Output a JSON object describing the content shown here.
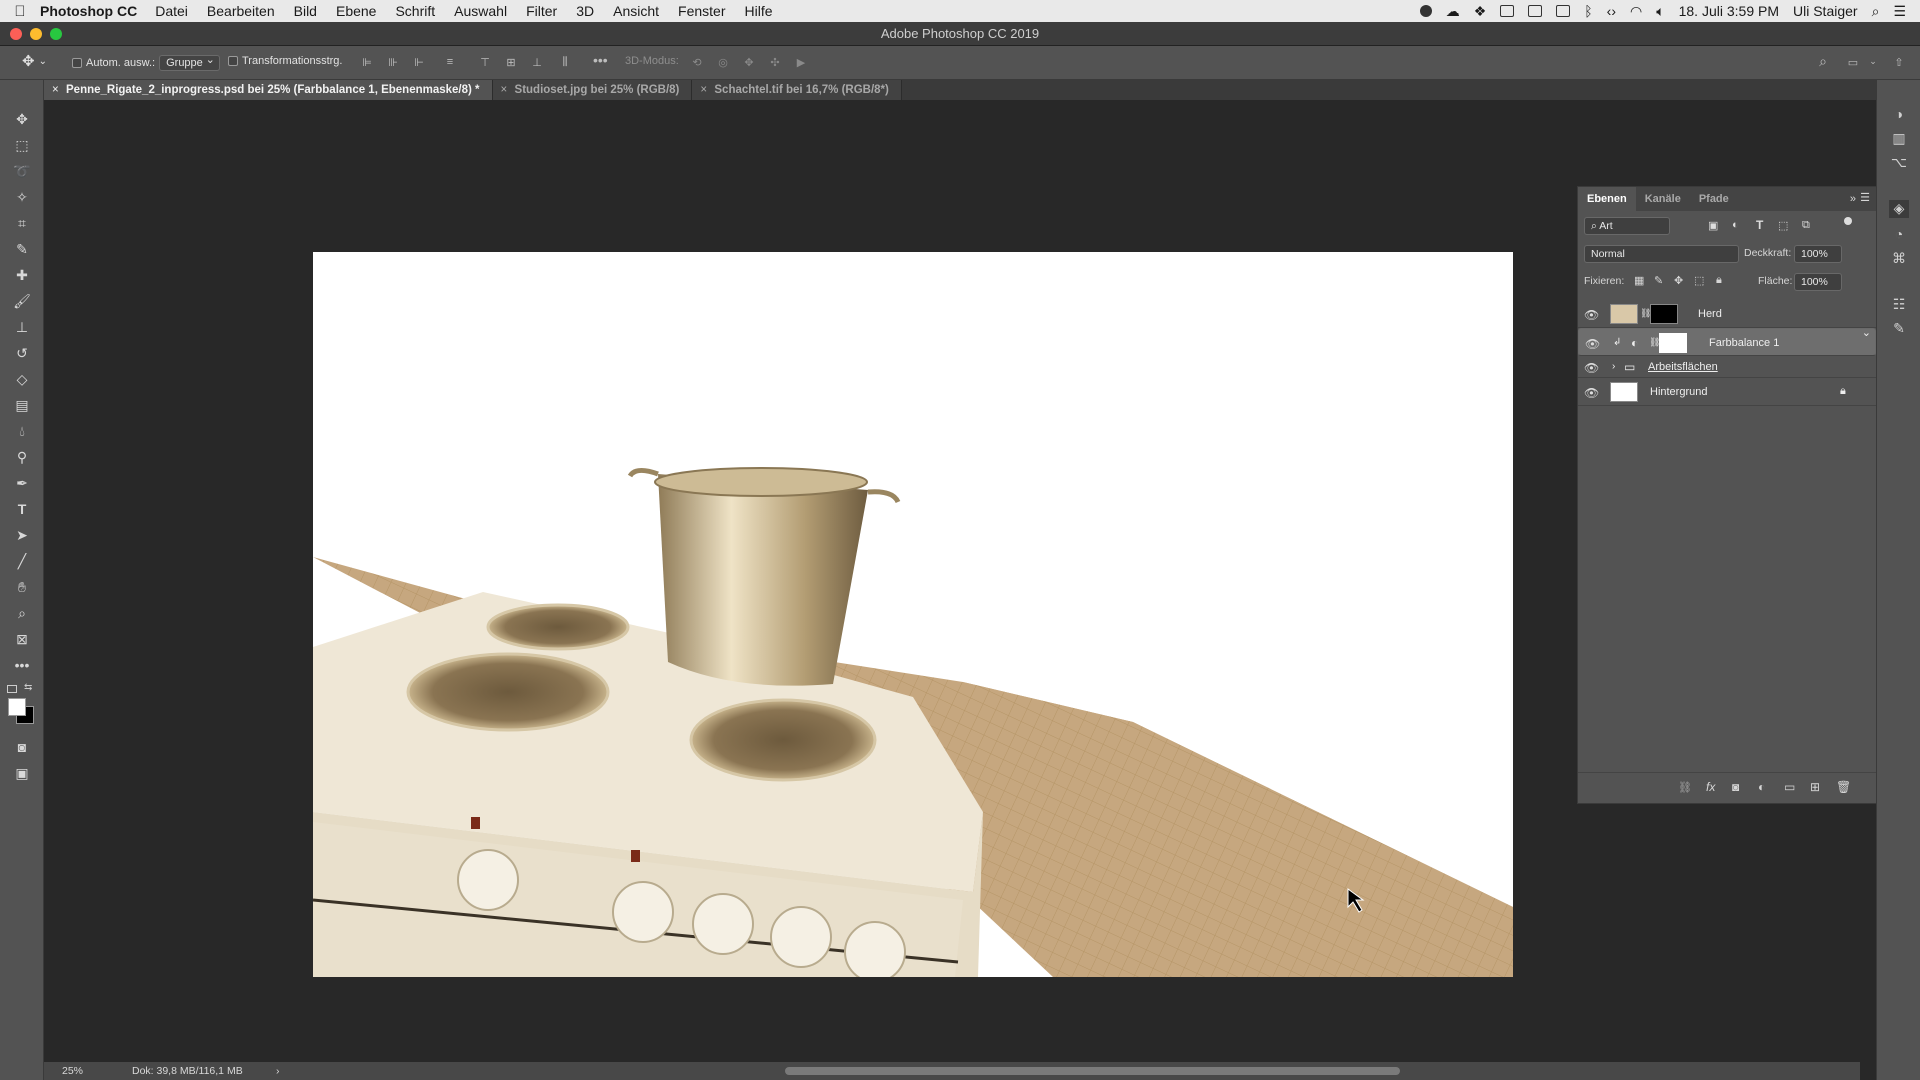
{
  "menubar": {
    "app_name": "Photoshop CC",
    "items": [
      "Datei",
      "Bearbeiten",
      "Bild",
      "Ebene",
      "Schrift",
      "Auswahl",
      "Filter",
      "3D",
      "Ansicht",
      "Fenster",
      "Hilfe"
    ],
    "date_time": "18. Juli  3:59 PM",
    "user": "Uli Staiger"
  },
  "window": {
    "title": "Adobe Photoshop CC 2019"
  },
  "options_bar": {
    "auto_select_label": "Autom. ausw.:",
    "auto_select_value": "Gruppe",
    "transform_label": "Transformationsstrg.",
    "mode_3d_label": "3D-Modus:"
  },
  "tabs": [
    {
      "label": "Penne_Rigate_2_inprogress.psd bei 25% (Farbbalance 1, Ebenenmaske/8) *",
      "active": true
    },
    {
      "label": "Studioset.jpg bei 25% (RGB/8)",
      "active": false
    },
    {
      "label": "Schachtel.tif bei 16,7% (RGB/8*)",
      "active": false
    }
  ],
  "layers_panel": {
    "tabs": [
      "Ebenen",
      "Kanäle",
      "Pfade"
    ],
    "filter_value": "Art",
    "blend_mode": "Normal",
    "opacity_label": "Deckkraft:",
    "opacity_value": "100%",
    "lock_label": "Fixieren:",
    "fill_label": "Fläche:",
    "fill_value": "100%",
    "layers": [
      {
        "name": "Herd",
        "selected": false
      },
      {
        "name": "Farbbalance 1",
        "selected": true
      },
      {
        "name": "Arbeitsflächen",
        "selected": false
      },
      {
        "name": "Hintergrund",
        "selected": false
      }
    ]
  },
  "status_bar": {
    "zoom": "25%",
    "doc_info": "Dok: 39,8 MB/116,1 MB",
    "arrow": "›"
  },
  "colors": {
    "panel_bg": "#535353",
    "canvas_bg": "#282828",
    "counter_wood": "#c8a982",
    "stove_cream": "#e9e0cd",
    "pot_brass": "#c8b48c"
  }
}
